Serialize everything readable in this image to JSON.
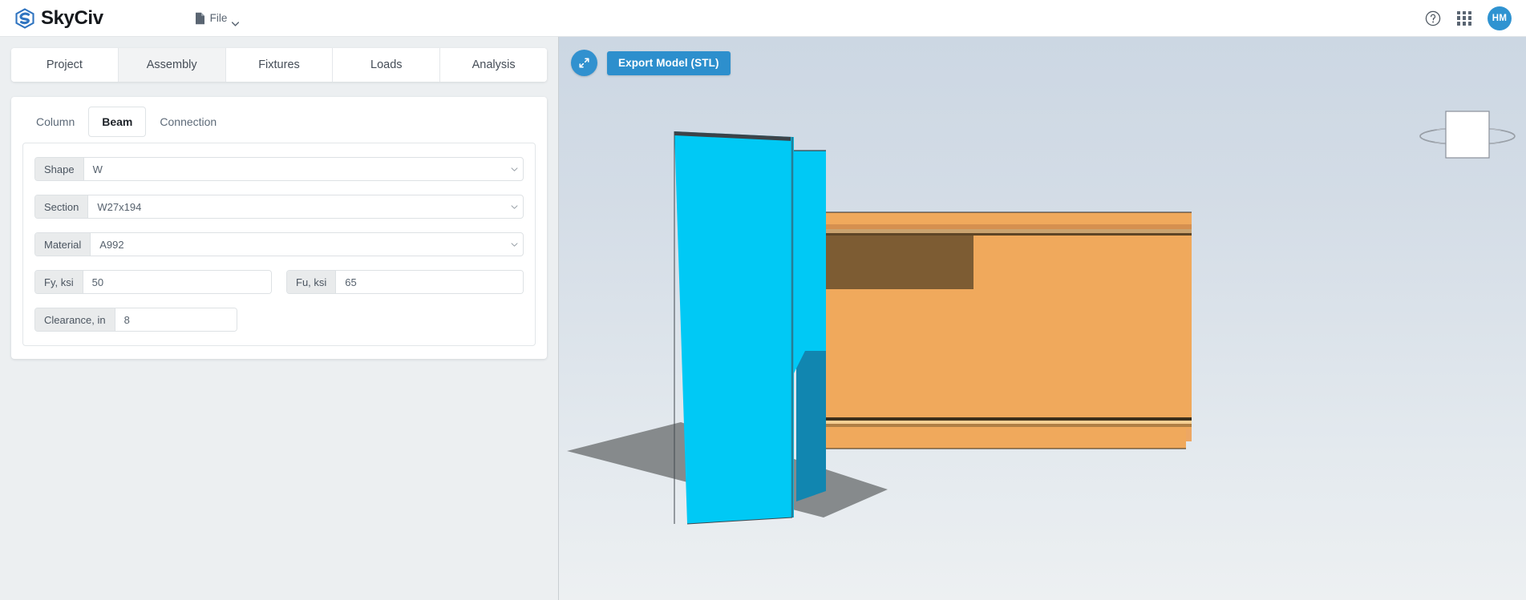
{
  "header": {
    "brand": "SkyCiv",
    "brand_icon": "skyciv-logo-icon",
    "file_menu": {
      "label": "File",
      "icon": "document-icon",
      "caret": "chevron-down-icon"
    },
    "help_icon": "help-circle-icon",
    "apps_icon": "apps-grid-icon",
    "avatar_initials": "HM"
  },
  "main_tabs": [
    {
      "label": "Project",
      "active": false
    },
    {
      "label": "Assembly",
      "active": true
    },
    {
      "label": "Fixtures",
      "active": false
    },
    {
      "label": "Loads",
      "active": false
    },
    {
      "label": "Analysis",
      "active": false
    }
  ],
  "sub_tabs": [
    {
      "label": "Column",
      "active": false
    },
    {
      "label": "Beam",
      "active": true
    },
    {
      "label": "Connection",
      "active": false
    }
  ],
  "form": {
    "shape": {
      "label": "Shape",
      "value": "W",
      "type": "select"
    },
    "section": {
      "label": "Section",
      "value": "W27x194",
      "type": "select"
    },
    "material": {
      "label": "Material",
      "value": "A992",
      "type": "select"
    },
    "fy": {
      "label": "Fy, ksi",
      "value": "50",
      "type": "text"
    },
    "fu": {
      "label": "Fu, ksi",
      "value": "65",
      "type": "text"
    },
    "clearance": {
      "label": "Clearance, in",
      "value": "8",
      "type": "text"
    }
  },
  "viewport": {
    "expand_button_icon": "expand-arrows-icon",
    "export_button_label": "Export Model (STL)",
    "view_gizmo_icon": "view-cube-gizmo-icon",
    "model": {
      "column_color": "#00c9f5",
      "column_side_color": "#1186b0",
      "beam_color": "#f0a95c",
      "beam_shadow_color": "#7d5c33",
      "beam_flange_top_color": "#eda763",
      "ground_shadow_color": "#868a8c",
      "background_top_color": "#ccd7e3",
      "background_bottom_color": "#edf0f2"
    }
  },
  "colors": {
    "accent_blue": "#2d8fcd",
    "avatar_blue": "#2f93d1",
    "panel_bg": "#eceff1",
    "text_dark": "#1c2127",
    "text_muted": "#5d6a78"
  }
}
